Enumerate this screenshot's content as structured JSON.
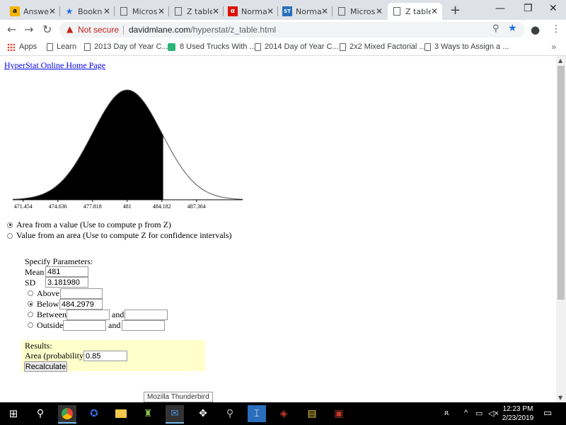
{
  "browser": {
    "tabs": [
      {
        "label": "Answe",
        "icon": "answers-icon",
        "active": false
      },
      {
        "label": "Bookn",
        "icon": "bookmark-star-icon",
        "active": false
      },
      {
        "label": "Micros",
        "icon": "document-icon",
        "active": false
      },
      {
        "label": "Z table",
        "icon": "document-icon",
        "active": false
      },
      {
        "label": "Norma",
        "icon": "wolfram-alpha-icon",
        "active": false
      },
      {
        "label": "Norma",
        "icon": "statology-icon",
        "active": false
      },
      {
        "label": "Micros",
        "icon": "document-icon",
        "active": false
      },
      {
        "label": "Z table",
        "icon": "document-icon",
        "active": true
      }
    ],
    "tab_close": "✕",
    "new_tab": "+",
    "window_controls": {
      "minimize": "—",
      "maximize": "❐",
      "close": "✕"
    },
    "security": "Not secure",
    "url_host": "davidmlane.com",
    "url_path": "/hyperstat/z_table.html",
    "bookmarks": [
      {
        "label": "Apps"
      },
      {
        "label": "Learn"
      },
      {
        "label": "2013 Day of Year C..."
      },
      {
        "label": "8 Used Trucks With ..."
      },
      {
        "label": "2014 Day of Year C..."
      },
      {
        "label": "2x2 Mixed Factorial ..."
      },
      {
        "label": "3 Ways to Assign a ..."
      }
    ],
    "bookmarks_more": "»"
  },
  "page": {
    "home_link": "HyperStat Online Home Page",
    "curve_ticks": [
      "471.454",
      "474.636",
      "477.818",
      "481",
      "484.182",
      "487.364"
    ],
    "mode_options": [
      {
        "label": "Area from a value (Use to compute p from Z)",
        "selected": true
      },
      {
        "label": "Value from an area (Use to compute Z for confidence intervals)",
        "selected": false
      }
    ],
    "specify_label": "Specify Parameters:",
    "mean_label": "Mean",
    "mean_value": "481",
    "sd_label": "SD",
    "sd_value": "3.181980",
    "above_label": "Above",
    "above_value": "",
    "below_label": "Below",
    "below_value": "484.2979",
    "between_label": "Between",
    "outside_label": "Outside",
    "and_label": "and",
    "selected_region": "Below",
    "results_label": "Results:",
    "area_label": "Area (probability)",
    "area_value": "0.85",
    "recalculate_label": "Recalculate",
    "tooltip": "Mozilla Thunderbird"
  },
  "taskbar": {
    "time": "12:23 PM",
    "date": "2/23/2019"
  },
  "colors": {
    "results_bg": "#ffffcc",
    "link": "#0000ee",
    "not_secure": "#c5221f",
    "tabstrip": "#dee1e6"
  }
}
